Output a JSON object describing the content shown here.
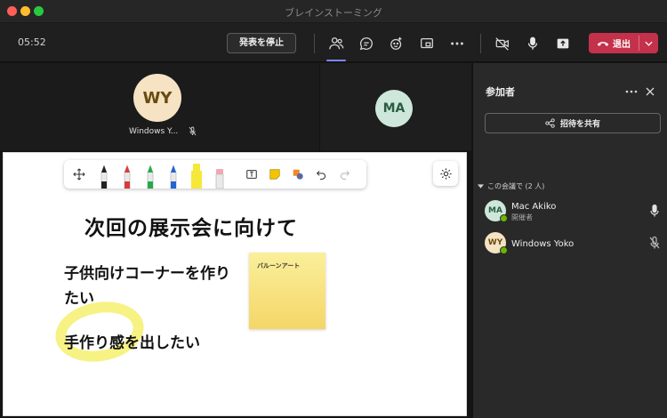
{
  "window": {
    "title": "ブレインストーミング"
  },
  "topbar": {
    "timer": "05:52",
    "stop_presenting_label": "発表を停止",
    "leave_label": "退出"
  },
  "video": {
    "tile1": {
      "initials": "WY",
      "name": "Windows Y..."
    },
    "tile2": {
      "initials": "MA"
    }
  },
  "whiteboard": {
    "heading": "次回の展示会に向けて",
    "text1": "子供向けコーナーを作りたい",
    "text2": "手作り感を出したい",
    "sticky_note": "バルーンアート",
    "pens": [
      "#222222",
      "#d83b3b",
      "#2aa84a",
      "#2463d1",
      "#f5e83a",
      "#f4a6b4"
    ]
  },
  "panel": {
    "title": "参加者",
    "share_invite_label": "招待を共有",
    "section_label": "この会議で (2 人)",
    "participants": [
      {
        "initials": "MA",
        "name": "Mac Akiko",
        "role": "開催者"
      },
      {
        "initials": "WY",
        "name": "Windows Yoko"
      }
    ]
  },
  "colors": {
    "accent": "#7f85f5",
    "leave": "#c4314b",
    "online": "#6bb700"
  }
}
